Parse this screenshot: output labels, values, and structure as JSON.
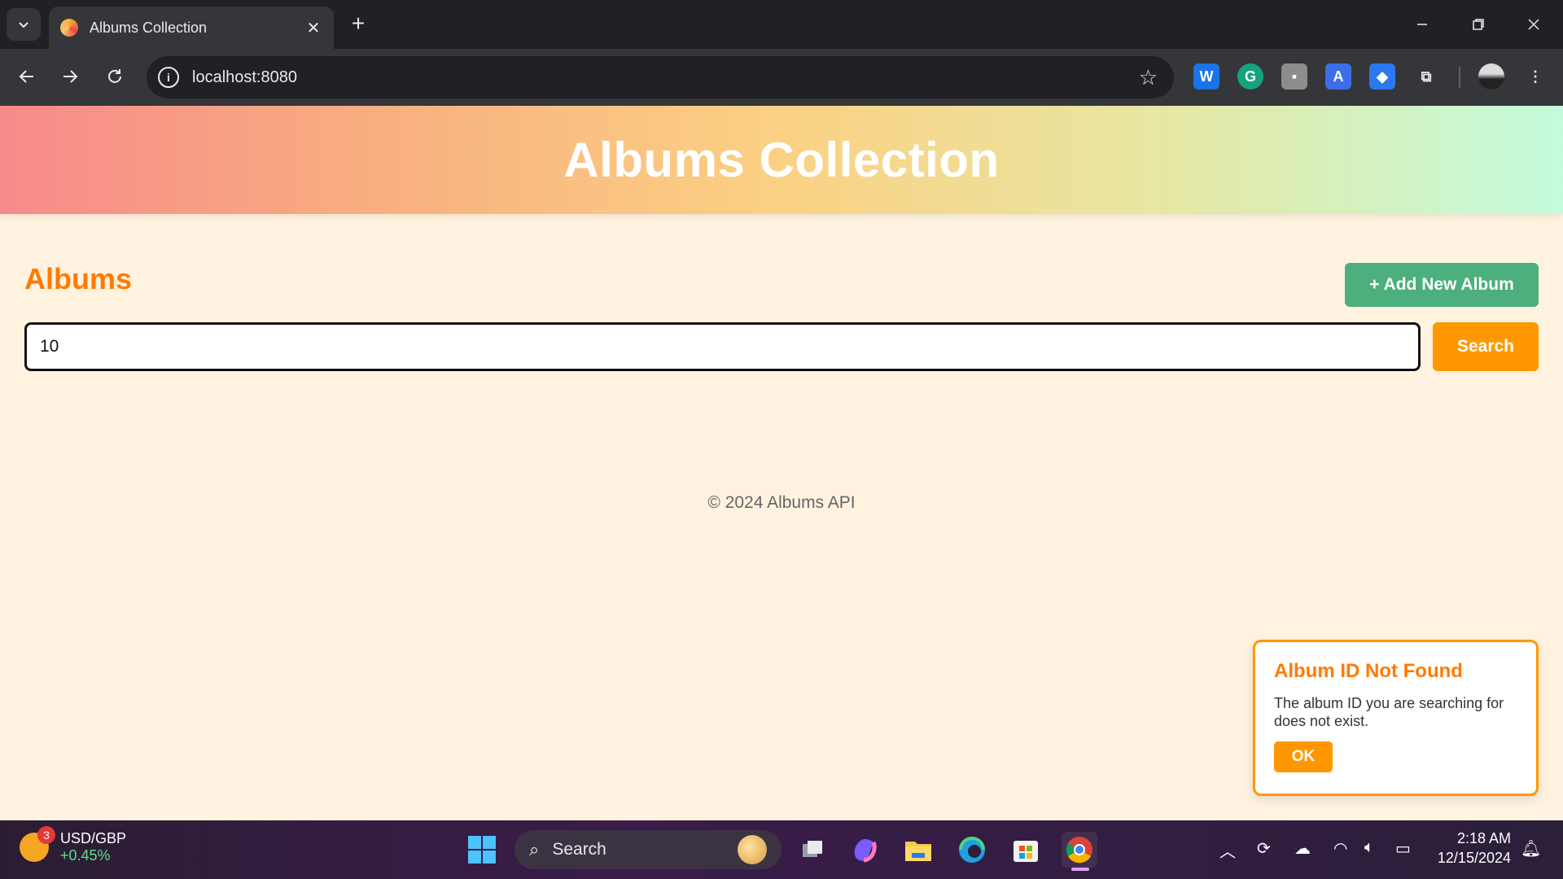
{
  "browser": {
    "tab_title": "Albums Collection",
    "url": "localhost:8080",
    "tab_close_glyph": "✕",
    "new_tab_glyph": "+"
  },
  "header": {
    "title": "Albums Collection"
  },
  "main": {
    "section_title": "Albums",
    "add_button": "+ Add New Album",
    "search_value": "10",
    "search_button": "Search"
  },
  "footer": {
    "text": "© 2024 Albums API"
  },
  "toast": {
    "title": "Album ID Not Found",
    "message": "The album ID you are searching for does not exist.",
    "ok_button": "OK"
  },
  "taskbar": {
    "widget_badge": "3",
    "widget_pair": "USD/GBP",
    "widget_change": "+0.45%",
    "search_placeholder": "Search",
    "time": "2:18 AM",
    "date": "12/15/2024"
  },
  "colors": {
    "accent_orange": "#ff9800",
    "title_orange": "#ff7a00",
    "add_green": "#4caf7d",
    "page_bg": "#fff3e0"
  }
}
